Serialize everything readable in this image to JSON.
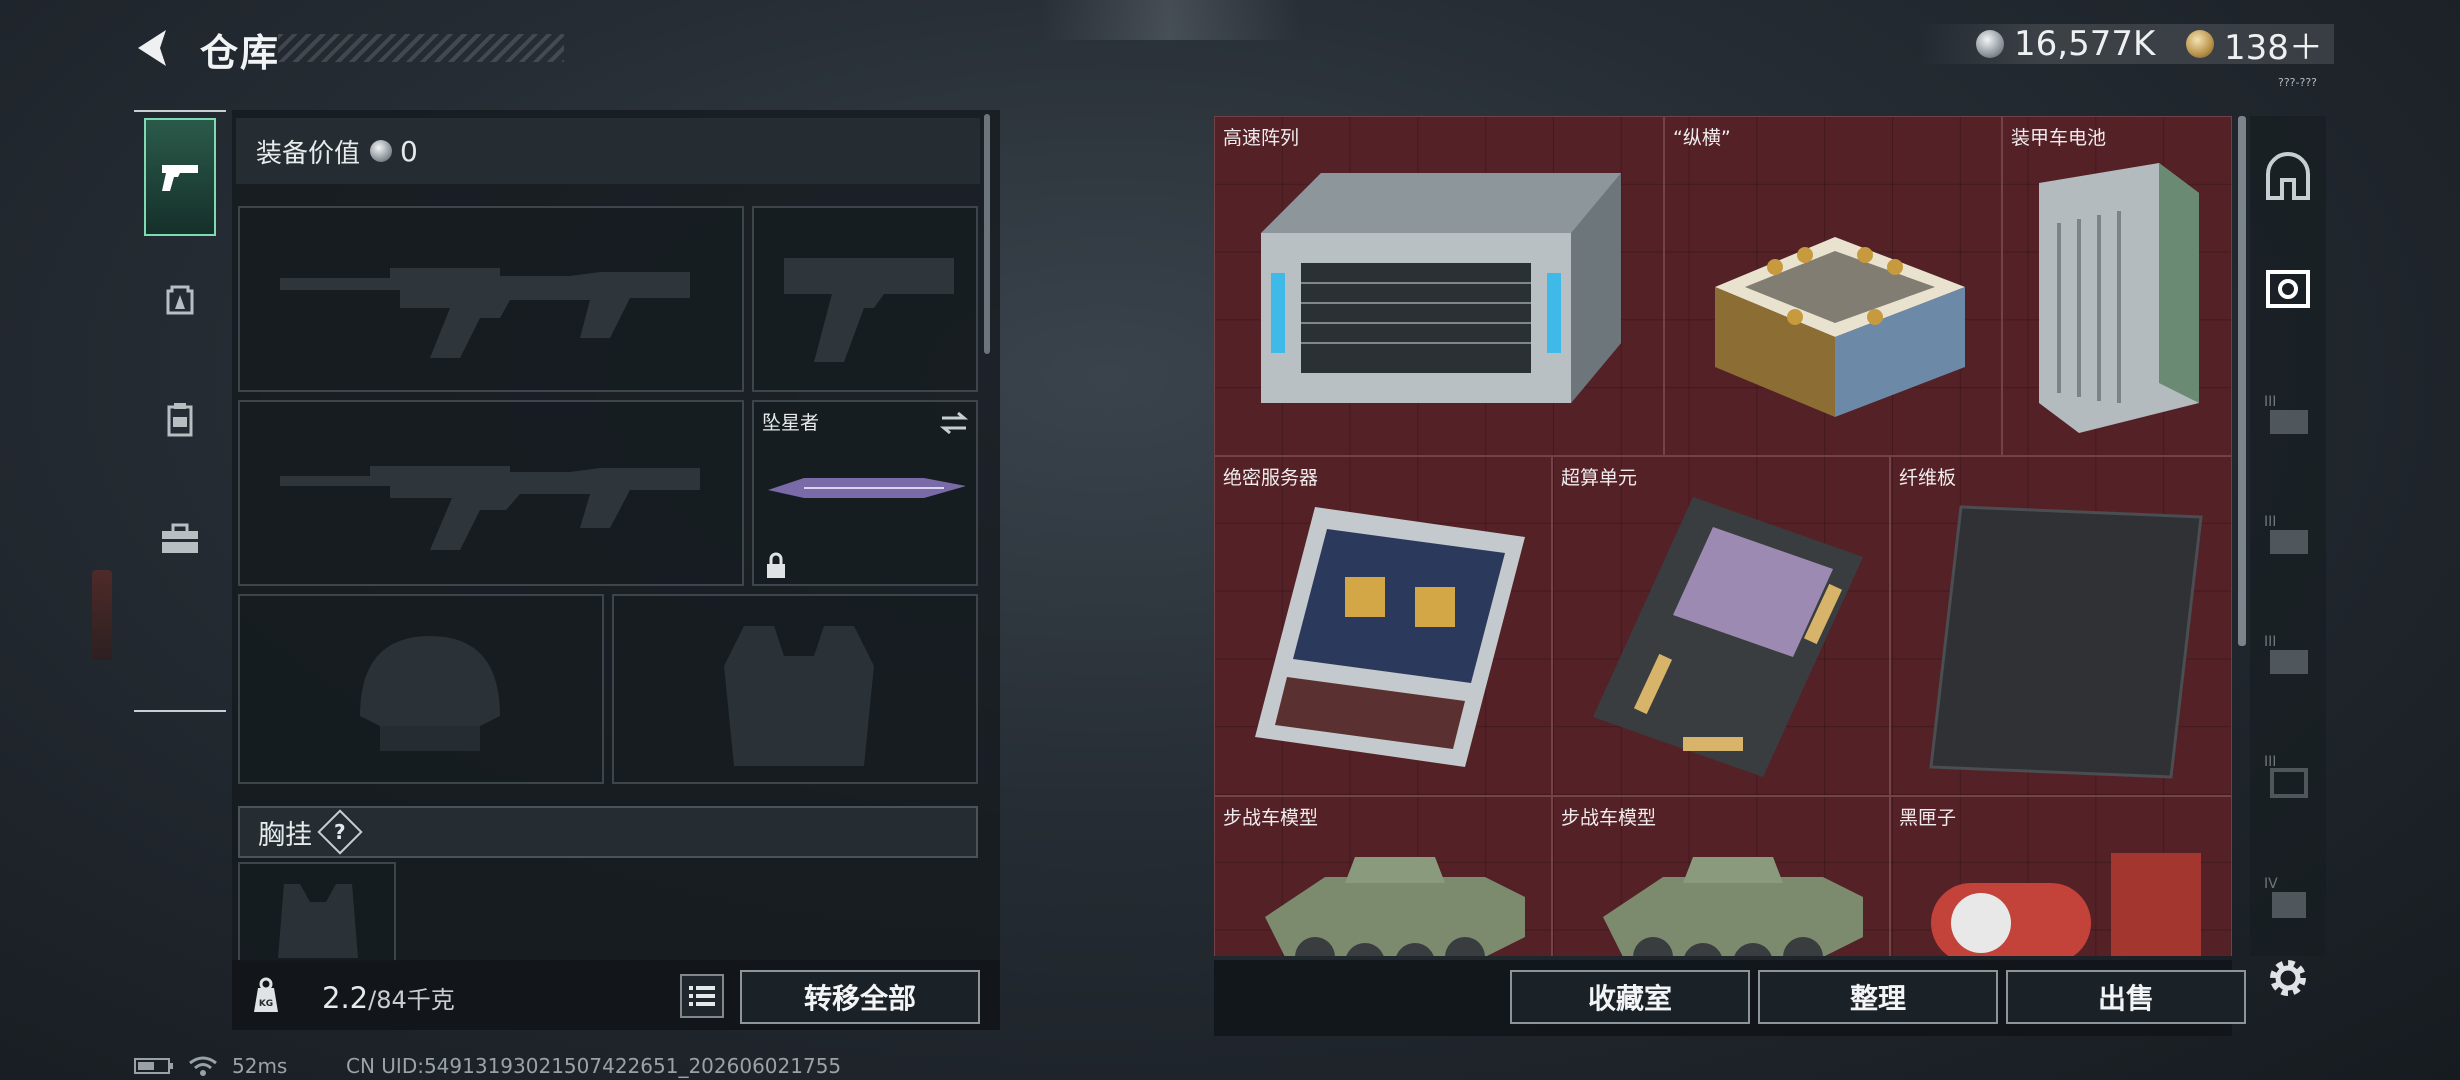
{
  "header": {
    "title": "仓库",
    "currency_primary": "16,577K",
    "currency_secondary": "138＋",
    "version_tag": "???-???"
  },
  "equipment": {
    "value_label": "装备价值",
    "value": "0",
    "slots": [
      {
        "id": "primary-weapon-1",
        "name": ""
      },
      {
        "id": "sidearm",
        "name": ""
      },
      {
        "id": "primary-weapon-2",
        "name": ""
      },
      {
        "id": "melee",
        "name": "坠星者"
      },
      {
        "id": "helmet",
        "name": ""
      },
      {
        "id": "armor",
        "name": ""
      }
    ],
    "chest_rig_label": "胸挂",
    "help_badge": "?",
    "weight_current": "2.2",
    "weight_max": "/84千克",
    "transfer_all": "转移全部"
  },
  "storage": {
    "items": [
      {
        "name": "高速阵列"
      },
      {
        "name": "“纵横”"
      },
      {
        "name": "装甲车电池"
      },
      {
        "name": "绝密服务器"
      },
      {
        "name": "超算单元"
      },
      {
        "name": "纤维板"
      },
      {
        "name": "步战车模型"
      },
      {
        "name": "步战车模型"
      },
      {
        "name": "黑匣子"
      }
    ],
    "collection_btn": "收藏室",
    "sort_btn": "整理",
    "sell_btn": "出售"
  },
  "status": {
    "ping": "52ms",
    "uid": "CN UID:549131930215074226​51_202606021755"
  },
  "colors": {
    "storage_bg": "#542127",
    "active_tab": "#7fd9b3",
    "panel_bg": "#141a1e"
  }
}
